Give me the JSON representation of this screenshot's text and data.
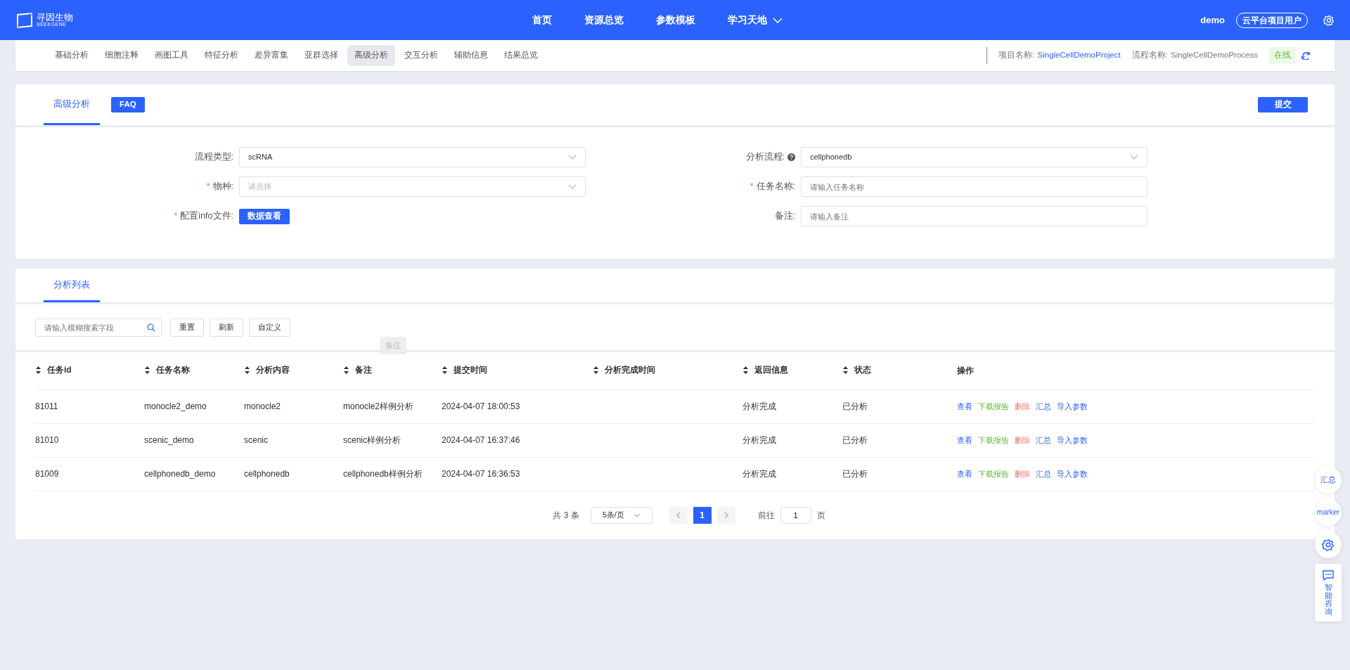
{
  "header": {
    "brand": "寻因生物",
    "brand_sub": "SEEKGENE",
    "nav": [
      {
        "label": "首页"
      },
      {
        "label": "资源总览"
      },
      {
        "label": "参数模板"
      },
      {
        "label": "学习天地",
        "dropdown": true
      }
    ],
    "user": "demo",
    "role": "云平台项目用户"
  },
  "subnav": {
    "tabs": [
      {
        "label": "基础分析",
        "selected": false
      },
      {
        "label": "细胞注释",
        "selected": false
      },
      {
        "label": "画图工具",
        "selected": false
      },
      {
        "label": "特征分析",
        "selected": false
      },
      {
        "label": "差异富集",
        "selected": false
      },
      {
        "label": "亚群选择",
        "selected": false
      },
      {
        "label": "高级分析",
        "selected": true
      },
      {
        "label": "交互分析",
        "selected": false
      },
      {
        "label": "辅助信息",
        "selected": false
      },
      {
        "label": "结果总览",
        "selected": false
      }
    ],
    "project_label": "项目名称:",
    "project": "SingleCellDemoProject",
    "process_label": "流程名称:",
    "process": "SingleCellDemoProcess",
    "status": "在线"
  },
  "form_card": {
    "tab": "高级分析",
    "faq": "FAQ",
    "submit": "提交",
    "fields": [
      {
        "label": "流程类型:",
        "kind": "select",
        "value": "scRNA"
      },
      {
        "label": "分析流程:",
        "help": true,
        "kind": "select",
        "value": "cellphonedb"
      },
      {
        "required_mark": "*",
        "label": "物种:",
        "kind": "select",
        "placeholder": "请选择"
      },
      {
        "required_mark": "*",
        "label": "任务名称:",
        "kind": "input",
        "placeholder": "请输入任务名称"
      },
      {
        "required_mark": "*",
        "label": "配置info文件:",
        "kind": "button",
        "button": "数据查看"
      },
      {
        "label": "备注:",
        "kind": "input",
        "placeholder": "请输入备注"
      }
    ]
  },
  "list_card": {
    "tab": "分析列表",
    "search_placeholder": "请输入模糊搜索字段",
    "buttons": [
      "重置",
      "刷新",
      "自定义"
    ],
    "tooltip": "备注",
    "columns": [
      {
        "label": "任务id",
        "sortable": true
      },
      {
        "label": "任务名称",
        "sortable": true
      },
      {
        "label": "分析内容",
        "sortable": true
      },
      {
        "label": "备注",
        "sortable": true
      },
      {
        "label": "提交时间",
        "sortable": true
      },
      {
        "label": "分析完成时间",
        "sortable": true
      },
      {
        "label": "返回信息",
        "sortable": true
      },
      {
        "label": "状态",
        "sortable": true
      },
      {
        "label": "操作",
        "sortable": false
      }
    ],
    "rows": [
      {
        "cells": [
          "81011",
          "monocle2_demo",
          "monocle2",
          "monocle2样例分析",
          "2024-04-07 18:00:53",
          "",
          "分析完成",
          "已分析"
        ],
        "actions": [
          {
            "label": "查看",
            "kind": "primary"
          },
          {
            "label": "下载报告",
            "kind": "success"
          },
          {
            "label": "删除",
            "kind": "danger"
          },
          {
            "label": "汇总",
            "kind": "primary"
          },
          {
            "label": "导入参数",
            "kind": "primary"
          }
        ]
      },
      {
        "cells": [
          "81010",
          "scenic_demo",
          "scenic",
          "scenic样例分析",
          "2024-04-07 16:37:46",
          "",
          "分析完成",
          "已分析"
        ],
        "actions": [
          {
            "label": "查看",
            "kind": "primary"
          },
          {
            "label": "下载报告",
            "kind": "success"
          },
          {
            "label": "删除",
            "kind": "danger"
          },
          {
            "label": "汇总",
            "kind": "primary"
          },
          {
            "label": "导入参数",
            "kind": "primary"
          }
        ]
      },
      {
        "cells": [
          "81009",
          "cellphonedb_demo",
          "cellphonedb",
          "cellphonedb样例分析",
          "2024-04-07 16:36:53",
          "",
          "分析完成",
          "已分析"
        ],
        "actions": [
          {
            "label": "查看",
            "kind": "primary"
          },
          {
            "label": "下载报告",
            "kind": "success"
          },
          {
            "label": "删除",
            "kind": "danger"
          },
          {
            "label": "汇总",
            "kind": "primary"
          },
          {
            "label": "导入参数",
            "kind": "primary"
          }
        ]
      }
    ],
    "pagination": {
      "total": "共 3 条",
      "page_size": "5条/页",
      "pages": [
        {
          "label": "1",
          "selected": true
        }
      ],
      "goto": "前往",
      "goto_value": "1",
      "page_unit": "页"
    }
  },
  "float_buttons": [
    {
      "kind": "text",
      "label": "汇总"
    },
    {
      "kind": "text",
      "label": "marker"
    },
    {
      "kind": "gear"
    },
    {
      "kind": "chat",
      "label": "智能咨询"
    }
  ]
}
